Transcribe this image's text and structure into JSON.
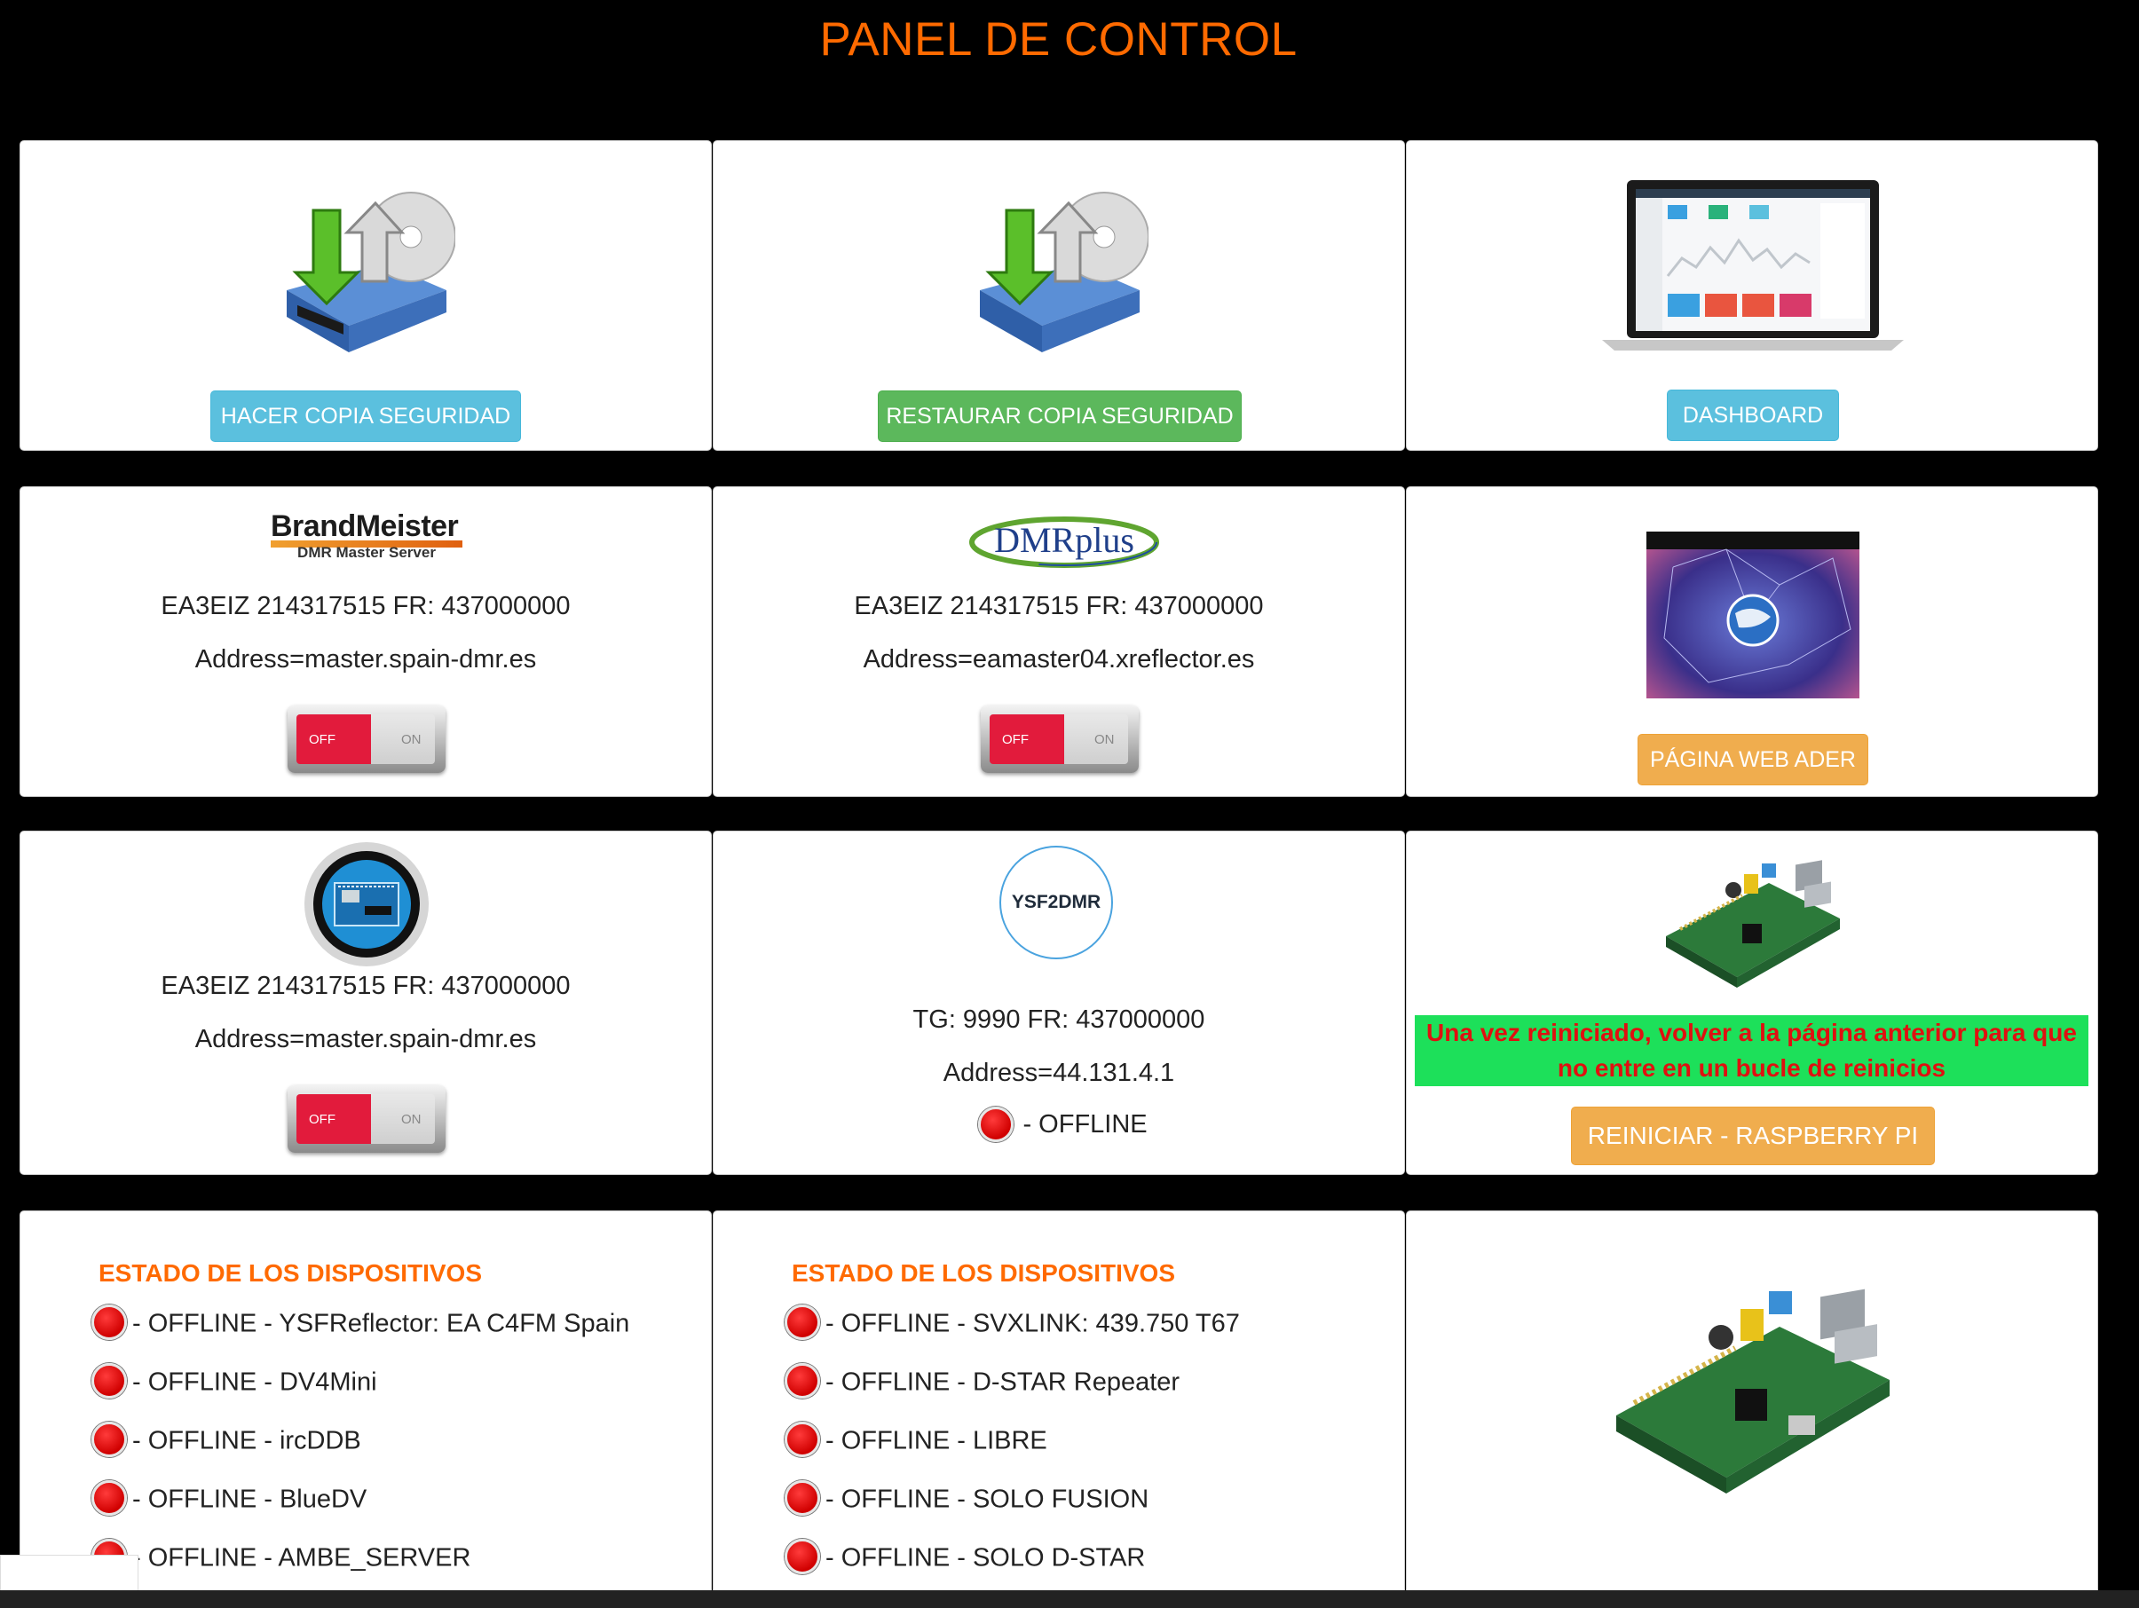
{
  "page": {
    "title": "PANEL DE CONTROL"
  },
  "row1": {
    "backup_button": "HACER COPIA SEGURIDAD",
    "restore_button": "RESTAURAR COPIA SEGURIDAD",
    "dashboard_button": "DASHBOARD"
  },
  "row2": {
    "brandmeister": {
      "logo_main": "BrandMeister",
      "logo_sub": "DMR Master Server",
      "info": "EA3EIZ 214317515 FR: 437000000",
      "address": "Address=master.spain-dmr.es",
      "toggle_off": "OFF",
      "toggle_on": "ON"
    },
    "dmrplus": {
      "logo": "DMRplus",
      "info": "EA3EIZ 214317515 FR: 437000000",
      "address": "Address=eamaster04.xreflector.es",
      "toggle_off": "OFF",
      "toggle_on": "ON"
    },
    "ader": {
      "button": "PÁGINA WEB ADER"
    }
  },
  "row3": {
    "arduino": {
      "info": "EA3EIZ 214317515 FR: 437000000",
      "address": "Address=master.spain-dmr.es",
      "toggle_off": "OFF",
      "toggle_on": "ON"
    },
    "ysf2dmr": {
      "logo": "YSF2DMR",
      "info": "TG: 9990 FR: 437000000",
      "address": "Address=44.131.4.1",
      "status": "- OFFLINE"
    },
    "raspberry": {
      "notice": "Una vez reiniciado, volver a la página anterior para que no entre en un bucle de reinicios",
      "button": "REINICIAR - RASPBERRY PI"
    }
  },
  "row4": {
    "left": {
      "title": "ESTADO DE LOS DISPOSITIVOS",
      "items": [
        "- OFFLINE - YSFReflector: EA C4FM Spain",
        "- OFFLINE - DV4Mini",
        "- OFFLINE - ircDDB",
        "- OFFLINE - BlueDV",
        "- OFFLINE - AMBE_SERVER"
      ]
    },
    "middle": {
      "title": "ESTADO DE LOS DISPOSITIVOS",
      "items": [
        "- OFFLINE - SVXLINK: 439.750 T67",
        "- OFFLINE - D-STAR Repeater",
        "- OFFLINE - LIBRE",
        "- OFFLINE - SOLO FUSION",
        "- OFFLINE - SOLO D-STAR"
      ]
    }
  },
  "colors": {
    "title": "#ff6a00",
    "info": "#5bc0de",
    "success": "#5cb85c",
    "warning": "#f0ad4e",
    "offline": "#ff0000",
    "notice_bg": "#1de05a",
    "notice_text": "#e01010"
  }
}
